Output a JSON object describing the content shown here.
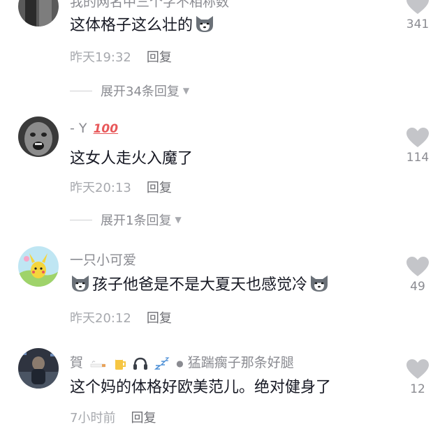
{
  "comments": [
    {
      "username": "我的网名中三个字不相称数",
      "text": "这体格子这么壮的",
      "time": "昨天19:32",
      "reply": "回复",
      "expand": "展开34条回复",
      "likes": "341",
      "emoji_after": "husky-dog-emoji"
    },
    {
      "username": "- Y",
      "badge": "💯",
      "text": "这女人走火入魔了",
      "time": "昨天20:13",
      "reply": "回复",
      "expand": "展开1条回复",
      "likes": "114"
    },
    {
      "username": "一只小可爱",
      "text": "孩子他爸是不是大夏天也感觉冷",
      "time": "昨天20:12",
      "reply": "回复",
      "likes": "49",
      "emoji_before": "husky-dog-emoji",
      "emoji_after": "husky-dog-emoji"
    },
    {
      "username_prefix": "賀",
      "username_suffix": "猛踹瘸子那条好腿",
      "text": "这个妈的体格好欧美范儿。绝对健身了",
      "time": "7小时前",
      "reply": "回复",
      "likes": "12"
    }
  ],
  "icons": [
    "heart-icon",
    "caret-down-icon",
    "husky-dog-emoji",
    "hundred-points-emoji",
    "beer-emoji",
    "headphones-emoji",
    "zzz-emoji"
  ],
  "colors": {
    "text": "#161823",
    "muted": "#8a8b91",
    "heart": "#c4c5c9"
  }
}
